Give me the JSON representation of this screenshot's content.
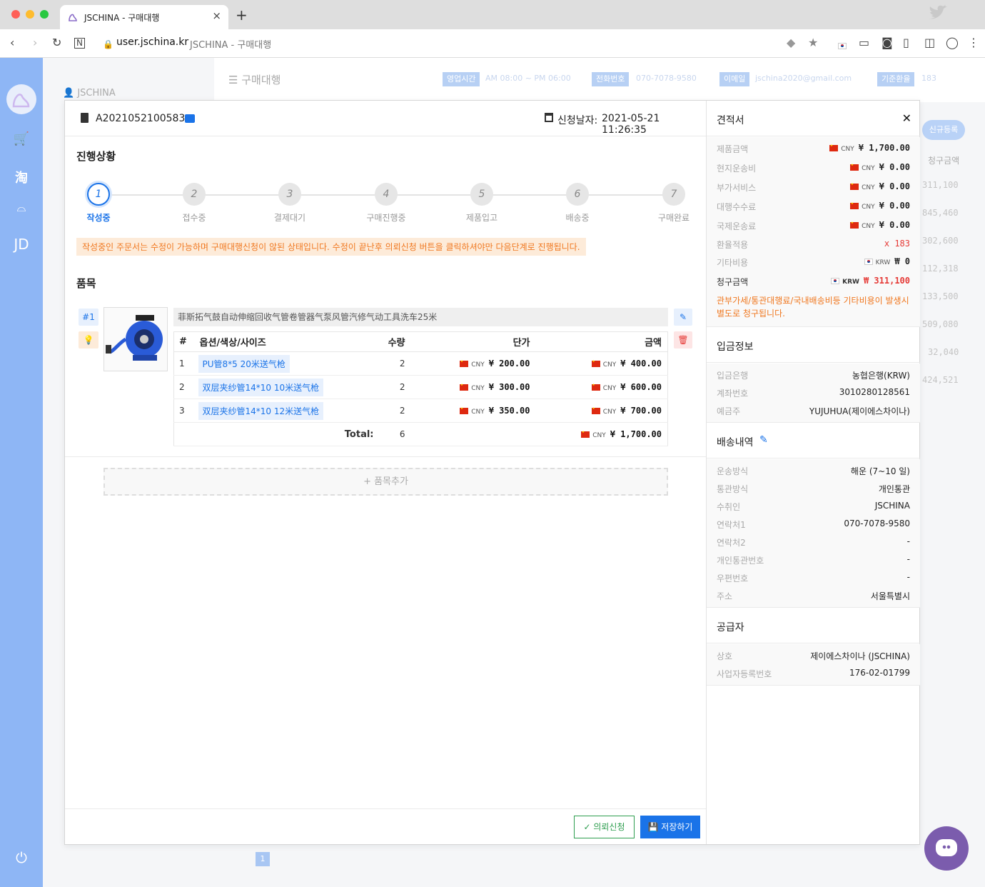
{
  "browser": {
    "tab_title": "JSCHINA - 구매대행",
    "url_host": "user.jschina.kr",
    "url_title": "JSCHINA - 구매대행"
  },
  "sidebar": {
    "items": [
      "cart-icon",
      "taobao",
      "1688",
      "JD"
    ],
    "jd_label": "JD",
    "tao_label": "淘"
  },
  "background": {
    "page_title": "구매대행",
    "user": "JSCHINA",
    "hours_label": "영업시간",
    "hours_value": "AM 08:00 ~ PM 06:00",
    "phone_label": "전화번호",
    "phone_value": "070-7078-9580",
    "email_label": "이메일",
    "email_value": "jschina2020@gmail.com",
    "rate_label": "기준환율",
    "rate_value": "183",
    "new_button": "신규등록",
    "col_header": "청구금액",
    "values": [
      "311,100",
      "845,460",
      "302,600",
      "112,318",
      "133,500",
      "509,080",
      "32,040",
      "424,521"
    ],
    "page": "1"
  },
  "order": {
    "number": "A2021052100583",
    "date_label": "신청날자:",
    "date_value": "2021-05-21 11:26:35",
    "progress_title": "진행상황",
    "steps": [
      {
        "num": "1",
        "label": "작성중"
      },
      {
        "num": "2",
        "label": "접수중"
      },
      {
        "num": "3",
        "label": "결제대기"
      },
      {
        "num": "4",
        "label": "구매진행중"
      },
      {
        "num": "5",
        "label": "제품입고"
      },
      {
        "num": "6",
        "label": "배송중"
      },
      {
        "num": "7",
        "label": "구매완료"
      }
    ],
    "active_step": 1,
    "notice": "작성중인 주문서는 수정이 가능하며 구매대행신청이 않된 상태입니다. 수정이 끝난후 의뢰신청 버튼을 클릭하셔야만 다음단계로 진행됩니다.",
    "items_title": "품목",
    "item_no": "#1",
    "product_name": "菲斯拓气鼓自动伸缩回收气管卷管器气泵风管汽修气动工具洗车25米",
    "table_headers": [
      "#",
      "옵션/색상/사이즈",
      "수량",
      "단가",
      "금액"
    ],
    "rows": [
      {
        "no": "1",
        "option": "PU管8*5 20米送气枪",
        "qty": "2",
        "unit": "¥ 200.00",
        "amount": "¥ 400.00"
      },
      {
        "no": "2",
        "option": "双层夹纱管14*10 10米送气枪",
        "qty": "2",
        "unit": "¥ 300.00",
        "amount": "¥ 600.00"
      },
      {
        "no": "3",
        "option": "双层夹纱管14*10 12米送气枪",
        "qty": "2",
        "unit": "¥ 350.00",
        "amount": "¥ 700.00"
      }
    ],
    "currency": "CNY",
    "total_label": "Total:",
    "total_qty": "6",
    "total_amount": "¥ 1,700.00",
    "add_item": "+ 품목추가",
    "request_button": "의뢰신청",
    "save_button": "저장하기"
  },
  "quote": {
    "title": "견적서",
    "rows": [
      {
        "label": "제품금액",
        "cur": "CNY",
        "value": "¥ 1,700.00"
      },
      {
        "label": "현지운송비",
        "cur": "CNY",
        "value": "¥ 0.00"
      },
      {
        "label": "부가서비스",
        "cur": "CNY",
        "value": "¥ 0.00"
      },
      {
        "label": "대행수수료",
        "cur": "CNY",
        "value": "¥ 0.00"
      },
      {
        "label": "국제운송료",
        "cur": "CNY",
        "value": "¥ 0.00"
      }
    ],
    "rate_label": "환율적용",
    "rate_value": "x 183",
    "other_label": "기타비용",
    "other_cur": "KRW",
    "other_value": "₩ 0",
    "total_label": "청구금액",
    "total_cur": "KRW",
    "total_value": "₩ 311,100",
    "note": "관부가세/통관대행료/국내배송비등 기타비용이 발생시 별도로 청구됩니다."
  },
  "deposit": {
    "title": "입금정보",
    "rows": [
      {
        "label": "입금은행",
        "value": "농협은행(KRW)"
      },
      {
        "label": "계좌번호",
        "value": "3010280128561"
      },
      {
        "label": "예금주",
        "value": "YUJUHUA(제이에스차이나)"
      }
    ]
  },
  "shipping": {
    "title": "배송내역",
    "rows": [
      {
        "label": "운송방식",
        "value": "해운 (7~10 일)"
      },
      {
        "label": "통관방식",
        "value": "개인통관"
      },
      {
        "label": "수취인",
        "value": "JSCHINA"
      },
      {
        "label": "연락처1",
        "value": "070-7078-9580"
      },
      {
        "label": "연락처2",
        "value": "-"
      },
      {
        "label": "개인통관번호",
        "value": "-"
      },
      {
        "label": "우편번호",
        "value": "-"
      },
      {
        "label": "주소",
        "value": "서울특별시"
      }
    ]
  },
  "supplier": {
    "title": "공급자",
    "rows": [
      {
        "label": "상호",
        "value": "제이에스차이나 (JSCHINA)"
      },
      {
        "label": "사업자등록번호",
        "value": "176-02-01799"
      }
    ]
  },
  "colors": {
    "accent": "#1a73e8",
    "warning": "#f07820",
    "danger": "#e53935",
    "success": "#2e9e4f",
    "sidebar": "#8eb6f5"
  }
}
